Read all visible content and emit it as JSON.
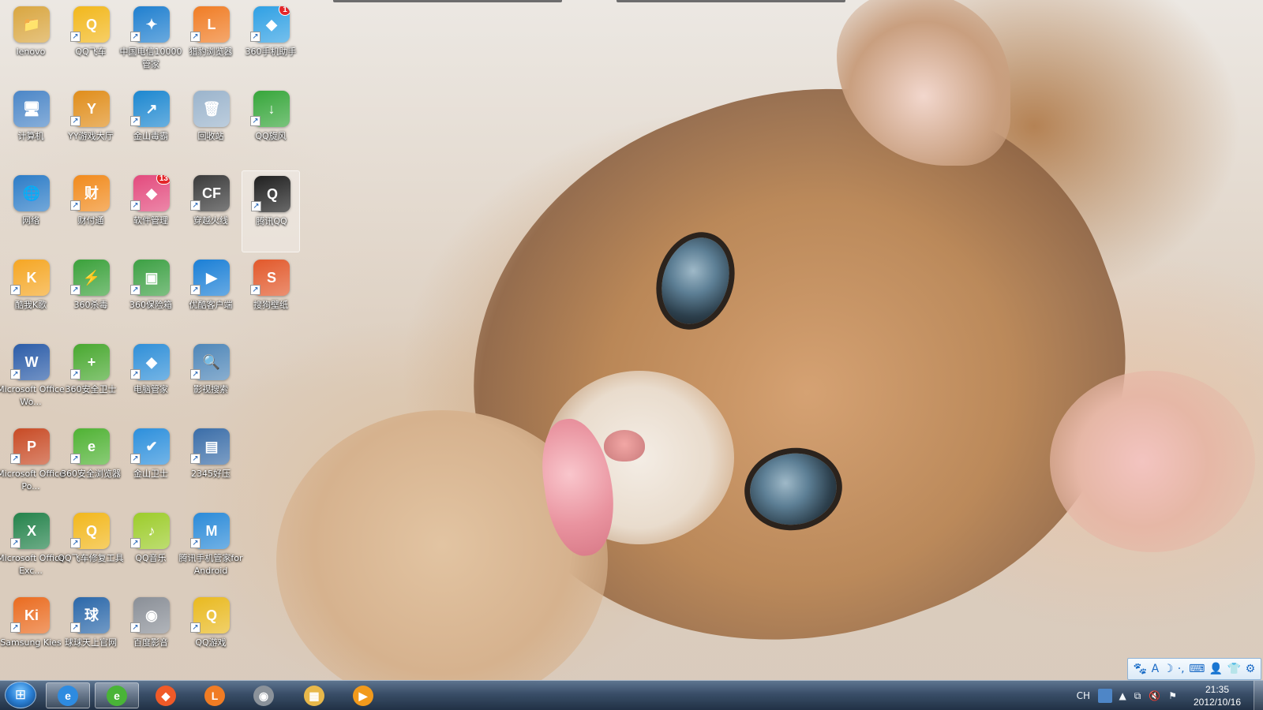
{
  "desktop": {
    "icons": [
      {
        "label": "lenovo",
        "icon": "user-folder-icon",
        "color": "#d9a640",
        "glyph": "📁",
        "shortcut": false
      },
      {
        "label": "QQ飞车",
        "icon": "qq-speed-icon",
        "color": "#f2b71b",
        "glyph": "Q",
        "shortcut": true
      },
      {
        "label": "中国电信10000管家",
        "icon": "telecom-icon",
        "color": "#1f7fcf",
        "glyph": "✦",
        "shortcut": true
      },
      {
        "label": "猎豹浏览器",
        "icon": "liebao-browser-icon",
        "color": "#f07c24",
        "glyph": "L",
        "shortcut": true
      },
      {
        "label": "360手机助手",
        "icon": "360-phone-assistant-icon",
        "color": "#2fa0e4",
        "glyph": "◆",
        "shortcut": true,
        "badge": "1"
      },
      {
        "label": "计算机",
        "icon": "computer-icon",
        "color": "#4b86c7",
        "glyph": "🖥",
        "shortcut": false
      },
      {
        "label": "YY游戏大厅",
        "icon": "yy-game-icon",
        "color": "#e08d1a",
        "glyph": "Y",
        "shortcut": true
      },
      {
        "label": "金山毒霸",
        "icon": "kingsoft-antivirus-icon",
        "color": "#1c87d0",
        "glyph": "↗",
        "shortcut": true
      },
      {
        "label": "回收站",
        "icon": "recycle-bin-icon",
        "color": "#9bb4cc",
        "glyph": "🗑",
        "shortcut": false
      },
      {
        "label": "QQ旋风",
        "icon": "qq-xuanfeng-icon",
        "color": "#36a63a",
        "glyph": "↓",
        "shortcut": true
      },
      {
        "label": "网络",
        "icon": "network-icon",
        "color": "#2c7cc7",
        "glyph": "🌐",
        "shortcut": false
      },
      {
        "label": "财付通",
        "icon": "tenpay-icon",
        "color": "#f18a1c",
        "glyph": "财",
        "shortcut": true
      },
      {
        "label": "软件管理",
        "icon": "software-manager-icon",
        "color": "#e34a7d",
        "glyph": "◆",
        "shortcut": true,
        "badge": "13"
      },
      {
        "label": "穿越火线",
        "icon": "crossfire-icon",
        "color": "#3a3a3a",
        "glyph": "CF",
        "shortcut": true
      },
      {
        "label": "腾讯QQ",
        "icon": "tencent-qq-icon",
        "color": "#1f1f1f",
        "glyph": "Q",
        "shortcut": true,
        "selected": true
      },
      {
        "label": "酷我K歌",
        "icon": "kuwo-karaoke-icon",
        "color": "#f5a623",
        "glyph": "K",
        "shortcut": true
      },
      {
        "label": "360杀毒",
        "icon": "360-antivirus-icon",
        "color": "#3aa13a",
        "glyph": "⚡",
        "shortcut": true
      },
      {
        "label": "360保险箱",
        "icon": "360-safebox-icon",
        "color": "#3ca043",
        "glyph": "▣",
        "shortcut": true
      },
      {
        "label": "优酷客户端",
        "icon": "youku-client-icon",
        "color": "#1a7fd6",
        "glyph": "▶",
        "shortcut": true
      },
      {
        "label": "搜狗壁纸",
        "icon": "sogou-wallpaper-icon",
        "color": "#e2582a",
        "glyph": "S",
        "shortcut": true
      },
      {
        "label": "Microsoft Office Wo...",
        "icon": "word-icon",
        "color": "#2b5ca8",
        "glyph": "W",
        "shortcut": true
      },
      {
        "label": "360安全卫士",
        "icon": "360-security-guard-icon",
        "color": "#48a82f",
        "glyph": "+",
        "shortcut": true
      },
      {
        "label": "电脑管家",
        "icon": "pc-manager-icon",
        "color": "#2f8fd8",
        "glyph": "◆",
        "shortcut": true
      },
      {
        "label": "影视搜索",
        "icon": "video-search-icon",
        "color": "#4e86b8",
        "glyph": "🔍",
        "shortcut": true
      },
      {
        "label": "Microsoft Office Po...",
        "icon": "powerpoint-icon",
        "color": "#c84a24",
        "glyph": "P",
        "shortcut": true
      },
      {
        "label": "360安全浏览器",
        "icon": "360-browser-icon",
        "color": "#4fb233",
        "glyph": "e",
        "shortcut": true
      },
      {
        "label": "金山卫士",
        "icon": "kingsoft-guard-icon",
        "color": "#2c8fdc",
        "glyph": "✔",
        "shortcut": true
      },
      {
        "label": "2345好压",
        "icon": "haozip-icon",
        "color": "#3a6da8",
        "glyph": "▤",
        "shortcut": true
      },
      {
        "label": "Microsoft Office Exc...",
        "icon": "excel-icon",
        "color": "#23824a",
        "glyph": "X",
        "shortcut": true
      },
      {
        "label": "QQ飞车修复工具",
        "icon": "qq-speed-repair-icon",
        "color": "#f2b71b",
        "glyph": "Q",
        "shortcut": true
      },
      {
        "label": "QQ音乐",
        "icon": "qq-music-icon",
        "color": "#9ccc2a",
        "glyph": "♪",
        "shortcut": true
      },
      {
        "label": "腾讯手机管家for Android",
        "icon": "tencent-mobile-manager-icon",
        "color": "#2a8ad8",
        "glyph": "M",
        "shortcut": true
      },
      {
        "label": "Samsung Kies",
        "icon": "samsung-kies-icon",
        "color": "#ea6b1f",
        "glyph": "Ki",
        "shortcut": true
      },
      {
        "label": "球球天上官网",
        "icon": "game-site-icon",
        "color": "#2a67a9",
        "glyph": "球",
        "shortcut": true
      },
      {
        "label": "百度影音",
        "icon": "baidu-player-icon",
        "color": "#8a8f97",
        "glyph": "◉",
        "shortcut": true
      },
      {
        "label": "QQ游戏",
        "icon": "qq-game-icon",
        "color": "#e9b91f",
        "glyph": "Q",
        "shortcut": true
      }
    ]
  },
  "ime_toolbar": {
    "items": [
      "🐾",
      "A",
      "☽",
      "·,",
      "⌨",
      "👤",
      "👕",
      "⚙"
    ]
  },
  "taskbar": {
    "start_glyph": "⊞",
    "buttons": [
      {
        "name": "ie-taskbar-button",
        "icon": "internet-explorer-icon",
        "color": "#2e8be0",
        "glyph": "e",
        "pinned": true
      },
      {
        "name": "360-browser-taskbar-button",
        "icon": "360-browser-icon",
        "color": "#49b437",
        "glyph": "e",
        "pinned": true
      },
      {
        "name": "360-phone-taskbar-button",
        "icon": "360-phone-assistant-icon",
        "color": "#f05a28",
        "glyph": "◆",
        "pinned": false
      },
      {
        "name": "liebao-taskbar-button",
        "icon": "liebao-browser-icon",
        "color": "#f07c24",
        "glyph": "L",
        "pinned": false
      },
      {
        "name": "baidu-player-taskbar-button",
        "icon": "baidu-player-icon",
        "color": "#8b929a",
        "glyph": "◉",
        "pinned": false
      },
      {
        "name": "explorer-taskbar-button",
        "icon": "folder-icon",
        "color": "#e8b84a",
        "glyph": "▦",
        "pinned": false
      },
      {
        "name": "media-player-taskbar-button",
        "icon": "media-player-icon",
        "color": "#f29a1c",
        "glyph": "▶",
        "pinned": false
      }
    ],
    "tray": {
      "language": "CH",
      "icons": [
        "▲",
        "⧉",
        "🔇",
        "⚑"
      ],
      "time": "21:35",
      "date": "2012/10/16"
    }
  }
}
